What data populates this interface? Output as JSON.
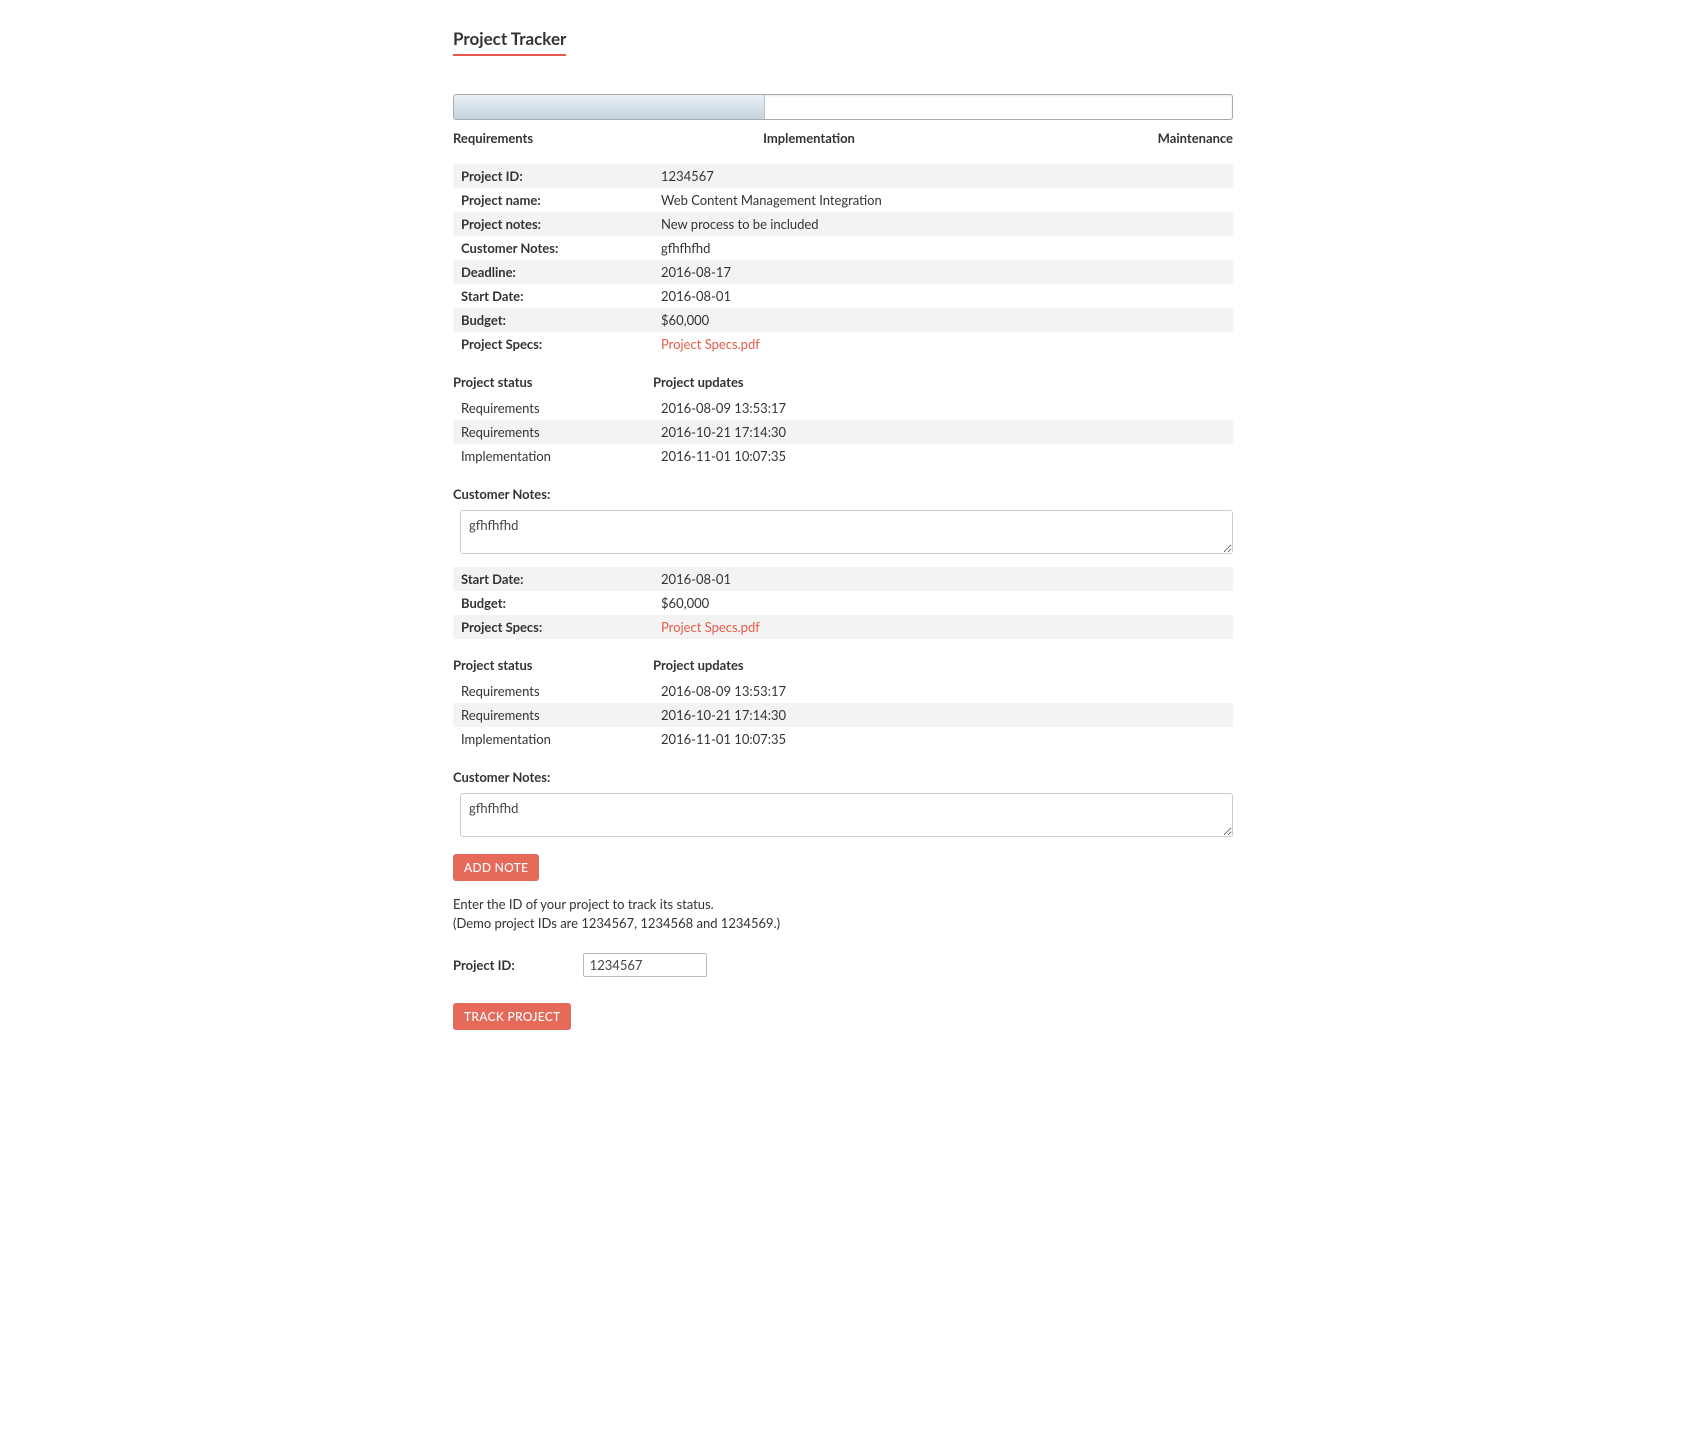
{
  "header": {
    "title": "Project Tracker"
  },
  "progress": {
    "percent": 40,
    "labels": {
      "left": "Requirements",
      "center": "Implementation",
      "right": "Maintenance"
    }
  },
  "details": {
    "rows": [
      {
        "label": "Project ID:",
        "value": "1234567"
      },
      {
        "label": "Project name:",
        "value": "Web Content Management Integration"
      },
      {
        "label": "Project notes:",
        "value": "New process to be included"
      },
      {
        "label": "Customer Notes:",
        "value": "gfhfhfhd"
      },
      {
        "label": "Deadline:",
        "value": "2016-08-17"
      },
      {
        "label": "Start Date:",
        "value": "2016-08-01"
      },
      {
        "label": "Budget:",
        "value": "$60,000"
      },
      {
        "label": "Project Specs:",
        "value": "Project Specs.pdf",
        "link": true
      }
    ]
  },
  "updatesHeader": {
    "status": "Project status",
    "updates": "Project updates"
  },
  "updates": [
    {
      "status": "Requirements",
      "ts": "2016-08-09 13:53:17"
    },
    {
      "status": "Requirements",
      "ts": "2016-10-21 17:14:30"
    },
    {
      "status": "Implementation",
      "ts": "2016-11-01 10:07:35"
    }
  ],
  "customerNotes": {
    "label": "Customer Notes:",
    "value": "gfhfhfhd"
  },
  "blockB": {
    "rows": [
      {
        "label": "Start Date:",
        "value": "2016-08-01"
      },
      {
        "label": "Budget:",
        "value": "$60,000"
      },
      {
        "label": "Project Specs:",
        "value": "Project Specs.pdf",
        "link": true
      }
    ]
  },
  "updates2": [
    {
      "status": "Requirements",
      "ts": "2016-08-09 13:53:17"
    },
    {
      "status": "Requirements",
      "ts": "2016-10-21 17:14:30"
    },
    {
      "status": "Implementation",
      "ts": "2016-11-01 10:07:35"
    }
  ],
  "buttons": {
    "addNote": "ADD NOTE",
    "trackProject": "TRACK PROJECT"
  },
  "instructions": {
    "line1": "Enter the ID of your project to track its status.",
    "line2": "(Demo project IDs are 1234567, 1234568 and 1234569.)"
  },
  "projectIdField": {
    "label": "Project ID:",
    "value": "1234567"
  }
}
